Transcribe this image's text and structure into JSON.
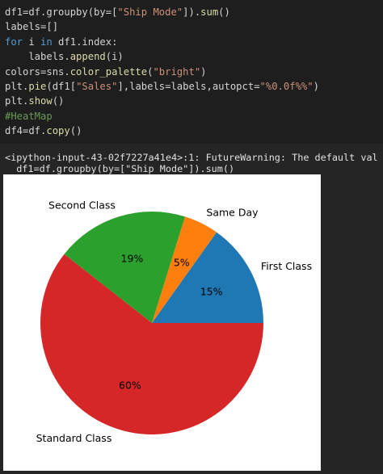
{
  "code_cell": {
    "lines": [
      [
        {
          "t": "df1=df.groupby(by=[",
          "c": "plain"
        },
        {
          "t": "\"Ship Mode\"",
          "c": "str"
        },
        {
          "t": "]).",
          "c": "plain"
        },
        {
          "t": "sum",
          "c": "fn"
        },
        {
          "t": "()",
          "c": "plain"
        }
      ],
      [
        {
          "t": "labels=[]",
          "c": "plain"
        }
      ],
      [
        {
          "t": "for",
          "c": "kw"
        },
        {
          "t": " i ",
          "c": "plain"
        },
        {
          "t": "in",
          "c": "kw"
        },
        {
          "t": " df1.index:",
          "c": "plain"
        }
      ],
      [
        {
          "t": "    labels.",
          "c": "plain"
        },
        {
          "t": "append",
          "c": "fn"
        },
        {
          "t": "(i)",
          "c": "plain"
        }
      ],
      [
        {
          "t": "colors=sns.",
          "c": "plain"
        },
        {
          "t": "color_palette",
          "c": "fn"
        },
        {
          "t": "(",
          "c": "plain"
        },
        {
          "t": "\"bright\"",
          "c": "str"
        },
        {
          "t": ")",
          "c": "plain"
        }
      ],
      [
        {
          "t": "plt.",
          "c": "plain"
        },
        {
          "t": "pie",
          "c": "fn"
        },
        {
          "t": "(df1[",
          "c": "plain"
        },
        {
          "t": "\"Sales\"",
          "c": "str"
        },
        {
          "t": "],labels=labels,autopct=",
          "c": "plain"
        },
        {
          "t": "\"%0.0f%%\"",
          "c": "str"
        },
        {
          "t": ")",
          "c": "plain"
        }
      ],
      [
        {
          "t": "plt.",
          "c": "plain"
        },
        {
          "t": "show",
          "c": "fn"
        },
        {
          "t": "()",
          "c": "plain"
        }
      ],
      [
        {
          "t": "#HeatMap",
          "c": "cmt"
        }
      ],
      [
        {
          "t": "df4=df.",
          "c": "plain"
        },
        {
          "t": "copy",
          "c": "fn"
        },
        {
          "t": "()",
          "c": "plain"
        }
      ]
    ]
  },
  "output": {
    "warning_line_1": "<ipython-input-43-02f7227a41e4>:1: FutureWarning: The default val",
    "warning_line_2": "  df1=df.groupby(by=[\"Ship Mode\"]).sum()"
  },
  "colors": {
    "First Class": "#1f77b4",
    "Same Day": "#ff7f0e",
    "Second Class": "#2ca02c",
    "Standard Class": "#d62728"
  },
  "chart_data": {
    "type": "pie",
    "labels": [
      "First Class",
      "Same Day",
      "Second Class",
      "Standard Class"
    ],
    "values": [
      15,
      5,
      19,
      60
    ],
    "autopct_labels": [
      "15%",
      "5%",
      "19%",
      "60%"
    ],
    "startangle": 0,
    "counterclock": true
  }
}
